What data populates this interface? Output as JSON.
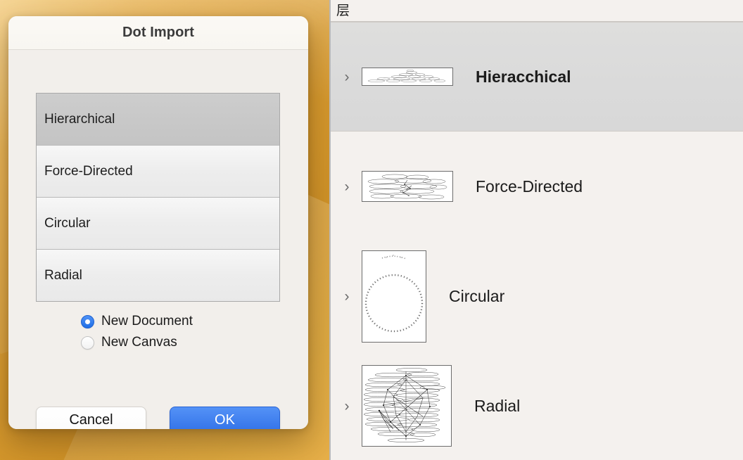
{
  "desktop": {
    "wallpaper_color": "#d79a2f"
  },
  "dialog": {
    "title": "Dot Import",
    "layout_list": {
      "items": [
        {
          "label": "Hierarchical",
          "selected": true
        },
        {
          "label": "Force-Directed",
          "selected": false
        },
        {
          "label": "Circular",
          "selected": false
        },
        {
          "label": "Radial",
          "selected": false
        }
      ]
    },
    "destination": {
      "options": [
        {
          "label": "New Document",
          "selected": true
        },
        {
          "label": "New Canvas",
          "selected": false
        }
      ]
    },
    "buttons": {
      "cancel": "Cancel",
      "ok": "OK"
    },
    "accent_color": "#3070e8"
  },
  "panel": {
    "header_title": "层",
    "rows": [
      {
        "label": "Hieracchical",
        "selected": true,
        "thumb": "hierarchical-thumbnail",
        "chevron": "›"
      },
      {
        "label": "Force-Directed",
        "selected": false,
        "thumb": "force-directed-thumbnail",
        "chevron": "›"
      },
      {
        "label": "Circular",
        "selected": false,
        "thumb": "circular-thumbnail",
        "chevron": "›"
      },
      {
        "label": "Radial",
        "selected": false,
        "thumb": "radial-thumbnail",
        "chevron": "›"
      }
    ]
  }
}
